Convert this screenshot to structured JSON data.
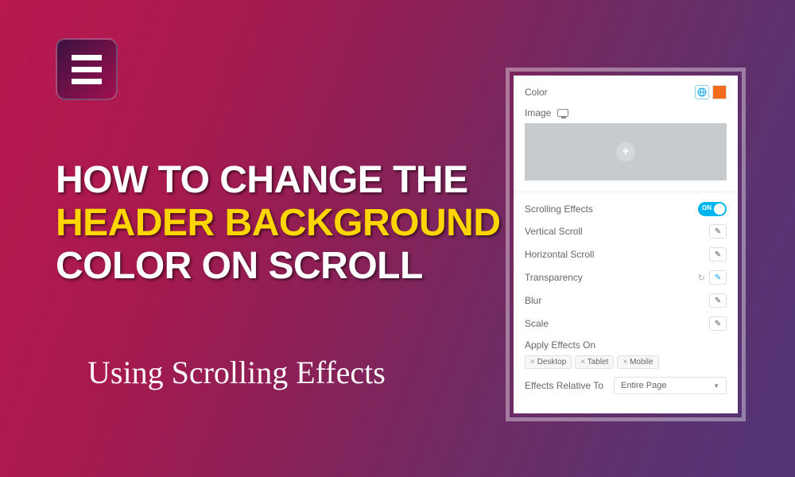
{
  "title": {
    "line1": "How to Change the",
    "line2": "Header Background",
    "line3": "Color on Scroll"
  },
  "subtitle": "Using Scrolling Effects",
  "panel": {
    "color_label": "Color",
    "color_value": "#f46b1d",
    "image_label": "Image",
    "scrolling_effects_label": "Scrolling Effects",
    "scrolling_effects_on": "ON",
    "effects": {
      "vertical": "Vertical Scroll",
      "horizontal": "Horizontal Scroll",
      "transparency": "Transparency",
      "blur": "Blur",
      "scale": "Scale"
    },
    "apply_on_label": "Apply Effects On",
    "devices": {
      "desktop": "Desktop",
      "tablet": "Tablet",
      "mobile": "Mobile"
    },
    "relative_label": "Effects Relative To",
    "relative_value": "Entire Page"
  }
}
